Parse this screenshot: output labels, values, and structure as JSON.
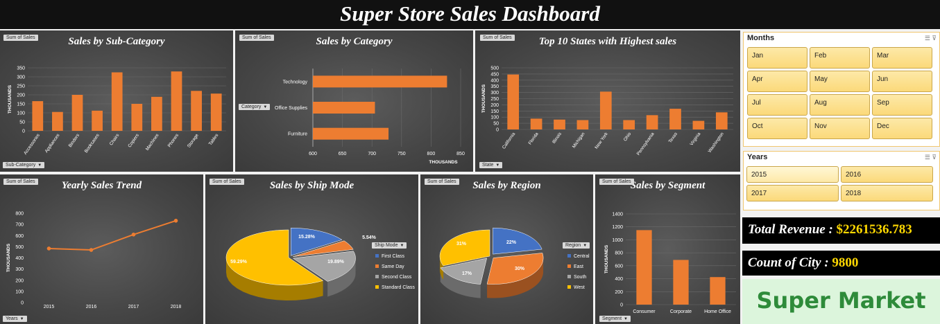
{
  "dashboard_title": "Super Store Sales Dashboard",
  "field_label": "Sum of Sales",
  "colors": {
    "bar": "#ed7d31",
    "gold": "#ffc000",
    "blue": "#4472c4",
    "gray": "#a5a5a5"
  },
  "panels": {
    "subcat": {
      "title": "Sales by Sub-Category",
      "filter": "Sub-Category",
      "ylabel": "THOUSANDS"
    },
    "category": {
      "title": "Sales by Category",
      "filter": "Category",
      "xlabel": "THOUSANDS"
    },
    "states": {
      "title": "Top 10 States with Highest sales",
      "filter": "State",
      "ylabel": "THOUSANDS"
    },
    "yearly": {
      "title": "Yearly Sales Trend",
      "filter": "Years",
      "ylabel": "THOUSANDS"
    },
    "shipmode": {
      "title": "Sales by Ship Mode",
      "legend_title": "Ship Mode"
    },
    "region": {
      "title": "Sales by Region",
      "legend_title": "Region"
    },
    "segment": {
      "title": "Sales by Segment",
      "filter": "Segment",
      "ylabel": "THOUSANDS"
    }
  },
  "chart_data": [
    {
      "type": "bar",
      "title": "Sales by Sub-Category",
      "categories": [
        "Accessories",
        "Appliances",
        "Binders",
        "Bookcases",
        "Chairs",
        "Copiers",
        "Machines",
        "Phones",
        "Storage",
        "Tables"
      ],
      "values": [
        165,
        105,
        200,
        112,
        325,
        150,
        189,
        330,
        222,
        207
      ],
      "ylabel": "THOUSANDS",
      "ylim": [
        0,
        350
      ],
      "yticks": [
        0,
        50,
        100,
        150,
        200,
        250,
        300,
        350
      ]
    },
    {
      "type": "bar",
      "title": "Sales by Category",
      "orientation": "horizontal",
      "categories": [
        "Technology",
        "Office Supplies",
        "Furniture"
      ],
      "values": [
        827,
        705,
        728
      ],
      "xlabel": "THOUSANDS",
      "xlim": [
        600,
        850
      ],
      "xticks": [
        600,
        650,
        700,
        750,
        800,
        850
      ]
    },
    {
      "type": "bar",
      "title": "Top 10 States with Highest sales",
      "categories": [
        "California",
        "Florida",
        "Illinois",
        "Michigan",
        "New York",
        "Ohio",
        "Pennsylvania",
        "Texas",
        "Virginia",
        "Washington"
      ],
      "values": [
        446,
        88,
        80,
        76,
        307,
        76,
        116,
        168,
        70,
        139
      ],
      "ylabel": "THOUSANDS",
      "ylim": [
        0,
        500
      ],
      "yticks": [
        0,
        50,
        100,
        150,
        200,
        250,
        300,
        350,
        400,
        450,
        500
      ]
    },
    {
      "type": "line",
      "title": "Yearly Sales Trend",
      "categories": [
        "2015",
        "2016",
        "2017",
        "2018"
      ],
      "values": [
        484,
        471,
        609,
        733
      ],
      "ylabel": "THOUSANDS",
      "ylim": [
        0,
        800
      ],
      "yticks": [
        0,
        100,
        200,
        300,
        400,
        500,
        600,
        700,
        800
      ]
    },
    {
      "type": "pie",
      "title": "Sales by Ship Mode",
      "series": [
        {
          "name": "First Class",
          "value": 15.28,
          "label": "15.28%"
        },
        {
          "name": "Same Day",
          "value": 5.54,
          "label": "5.54%"
        },
        {
          "name": "Second Class",
          "value": 19.89,
          "label": "19.89%"
        },
        {
          "name": "Standard Class",
          "value": 59.29,
          "label": "59.29%"
        }
      ]
    },
    {
      "type": "pie",
      "title": "Sales by Region",
      "series": [
        {
          "name": "Central",
          "value": 22,
          "label": "22%"
        },
        {
          "name": "East",
          "value": 30,
          "label": "30%"
        },
        {
          "name": "South",
          "value": 17,
          "label": "17%"
        },
        {
          "name": "West",
          "value": 31,
          "label": "31%"
        }
      ]
    },
    {
      "type": "bar",
      "title": "Sales by Segment",
      "categories": [
        "Consumer",
        "Corporate",
        "Home Office"
      ],
      "values": [
        1150,
        690,
        425
      ],
      "ylabel": "THOUSANDS",
      "ylim": [
        0,
        1400
      ],
      "yticks": [
        0,
        200,
        400,
        600,
        800,
        1000,
        1200,
        1400
      ]
    }
  ],
  "months_slicer": {
    "title": "Months",
    "items": [
      "Jan",
      "Feb",
      "Mar",
      "Apr",
      "May",
      "Jun",
      "Jul",
      "Aug",
      "Sep",
      "Oct",
      "Nov",
      "Dec"
    ]
  },
  "years_slicer": {
    "title": "Years",
    "items": [
      "2015",
      "2016",
      "2017",
      "2018"
    ]
  },
  "kpis": {
    "revenue_label": "Total Revenue : ",
    "revenue_value": "$2261536.783",
    "city_label": "Count of City : ",
    "city_value": "9800"
  },
  "logo_text": "Super Market"
}
